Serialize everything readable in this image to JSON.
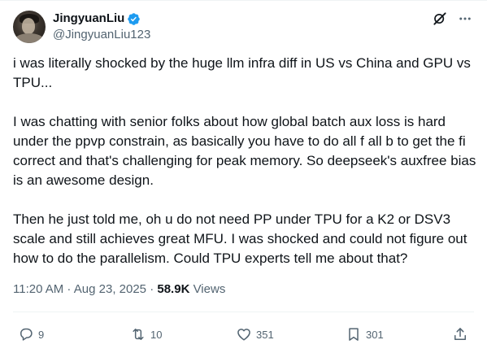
{
  "author": {
    "display_name": "JingyuanLiu",
    "handle": "@JingyuanLiu123",
    "verified": true
  },
  "tweet": {
    "paragraphs": [
      "i was literally shocked by the huge llm infra diff in US vs China and GPU vs TPU...",
      "I was chatting with senior folks about how global batch aux loss is hard under the ppvp constrain, as basically you have to do all f all b to get the fi correct and that's challenging for peak memory. So deepseek's auxfree bias is an awesome design.",
      "Then he just told me, oh u do not need PP under TPU for a K2 or DSV3 scale and still achieves great MFU. I was shocked and could not figure out how to do the parallelism. Could TPU experts tell me about that?"
    ]
  },
  "meta": {
    "time": "11:20 AM",
    "separator": " · ",
    "date": "Aug 23, 2025",
    "views_count": "58.9K",
    "views_label": " Views"
  },
  "actions": {
    "replies": "9",
    "reposts": "10",
    "likes": "351",
    "bookmarks": "301"
  },
  "icons": {
    "verified": "verified-badge-icon",
    "grok": "grok-icon",
    "more": "more-dots-icon",
    "reply": "reply-icon",
    "repost": "repost-icon",
    "like": "heart-icon",
    "bookmark": "bookmark-icon",
    "share": "share-icon"
  },
  "colors": {
    "text_primary": "#0f1419",
    "text_secondary": "#536471",
    "verified_blue": "#1d9bf0",
    "divider": "#eff3f4"
  }
}
